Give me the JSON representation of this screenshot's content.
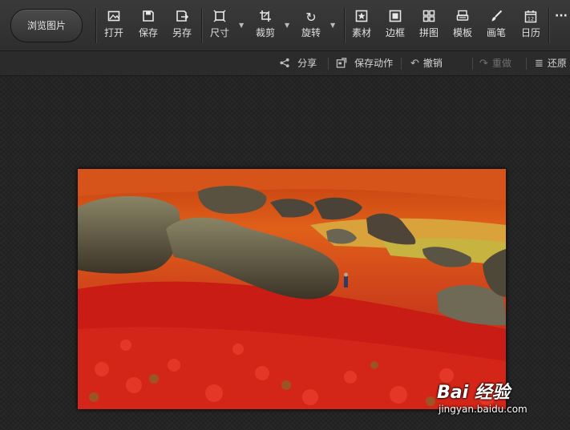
{
  "toolbar": {
    "browse_label": "浏览图片",
    "tools": [
      {
        "key": "open",
        "label": "打开",
        "icon": "open-image-icon"
      },
      {
        "key": "save",
        "label": "保存",
        "icon": "save-icon"
      },
      {
        "key": "save_as",
        "label": "另存",
        "icon": "save-as-icon"
      },
      {
        "key": "size",
        "label": "尺寸",
        "icon": "resize-icon"
      },
      {
        "key": "crop",
        "label": "裁剪",
        "icon": "crop-icon"
      },
      {
        "key": "rotate",
        "label": "旋转",
        "icon": "rotate-icon"
      },
      {
        "key": "material",
        "label": "素材",
        "icon": "sticker-icon"
      },
      {
        "key": "border",
        "label": "边框",
        "icon": "frame-icon"
      },
      {
        "key": "collage",
        "label": "拼图",
        "icon": "collage-icon"
      },
      {
        "key": "template",
        "label": "模板",
        "icon": "template-icon"
      },
      {
        "key": "brush",
        "label": "画笔",
        "icon": "brush-icon"
      },
      {
        "key": "calendar",
        "label": "日历",
        "icon": "calendar-icon"
      }
    ],
    "calendar_day": "12",
    "more_label": "···"
  },
  "subbar": {
    "share": "分享",
    "save_action": "保存动作",
    "undo": "撤销",
    "redo": "重做",
    "restore": "还原"
  },
  "watermark": {
    "logo": "Bai  经验",
    "url": "jingyan.baidu.com"
  }
}
